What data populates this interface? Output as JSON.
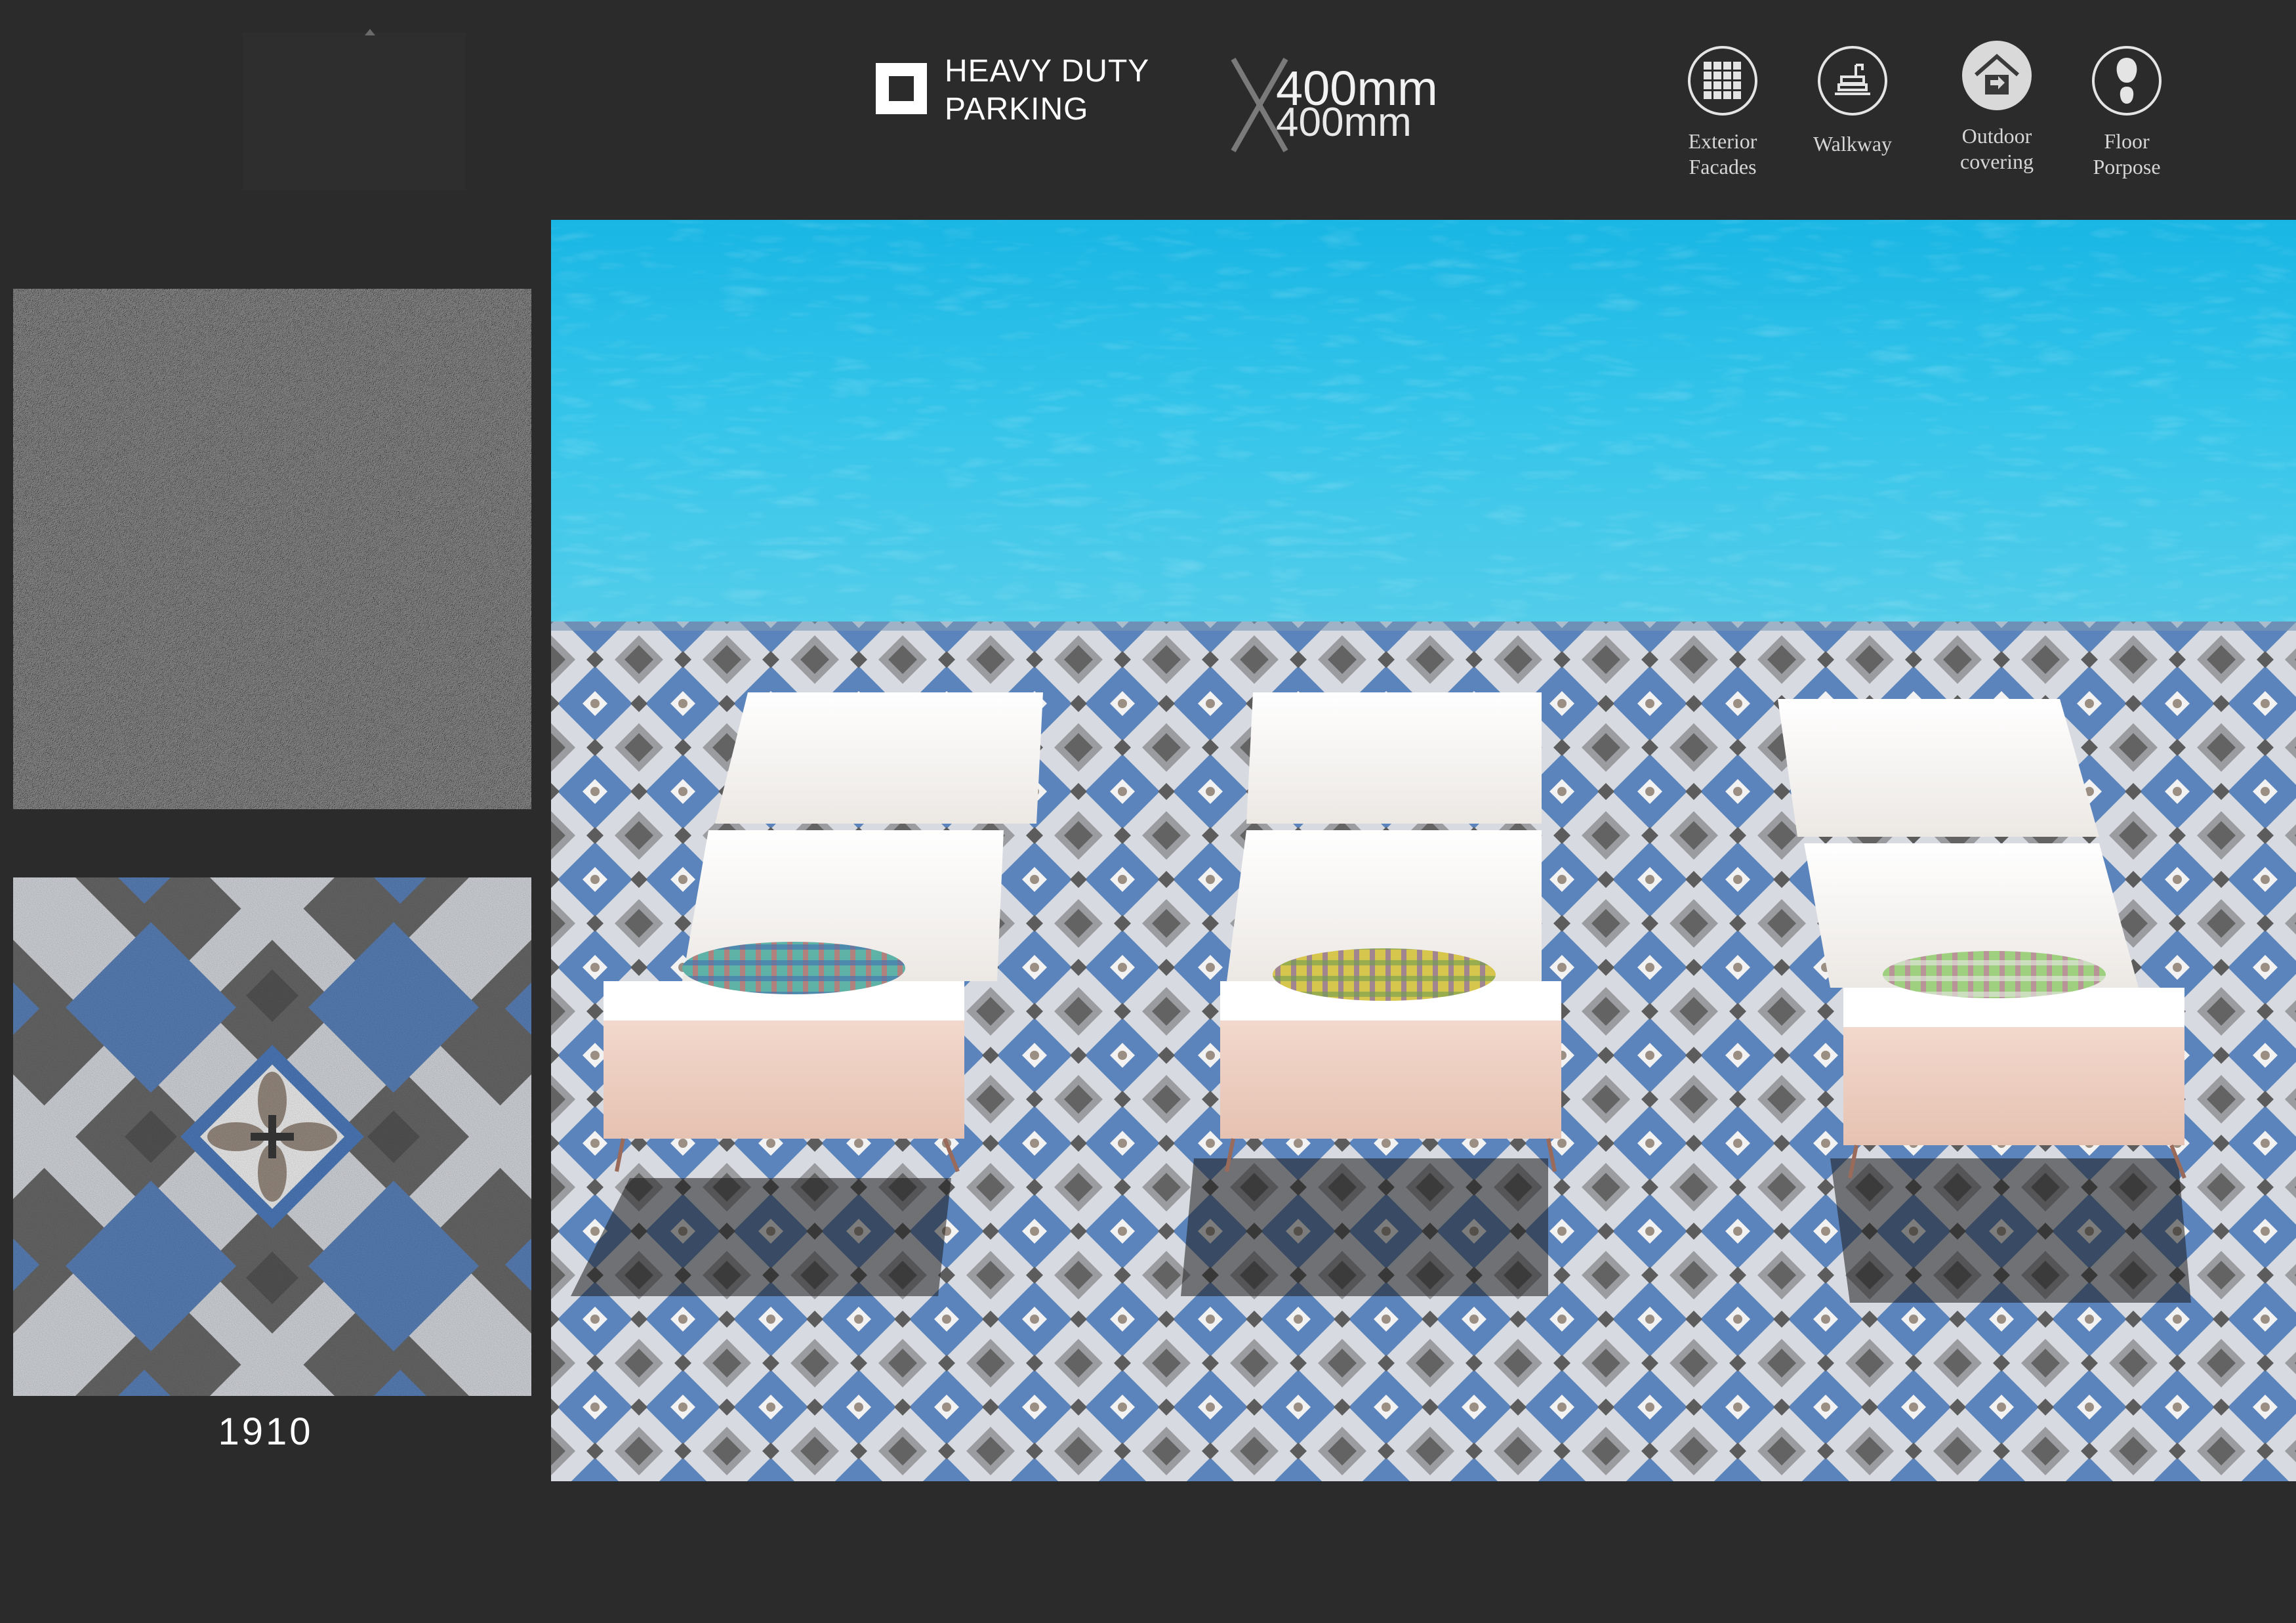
{
  "header": {
    "feature_line1": "HEAVY DUTY",
    "feature_line2": "PARKING",
    "size_width": "400mm",
    "size_height": "400mm"
  },
  "applications": [
    {
      "label": "Exterior\nFacades",
      "icon": "grid-facade-icon"
    },
    {
      "label": "Walkway",
      "icon": "walkway-icon"
    },
    {
      "label": "Outdoor\ncovering",
      "icon": "house-icon"
    },
    {
      "label": "Floor\nPorpose",
      "icon": "footprint-icon"
    }
  ],
  "product": {
    "code": "1910"
  },
  "colors": {
    "background": "#2b2b2b",
    "pool_water": "#2fc0e6",
    "tile_blue": "#5b84bc",
    "tile_light": "#dde0e6",
    "tile_dark": "#5a5a5a",
    "lounger": "#f4f1ee"
  }
}
